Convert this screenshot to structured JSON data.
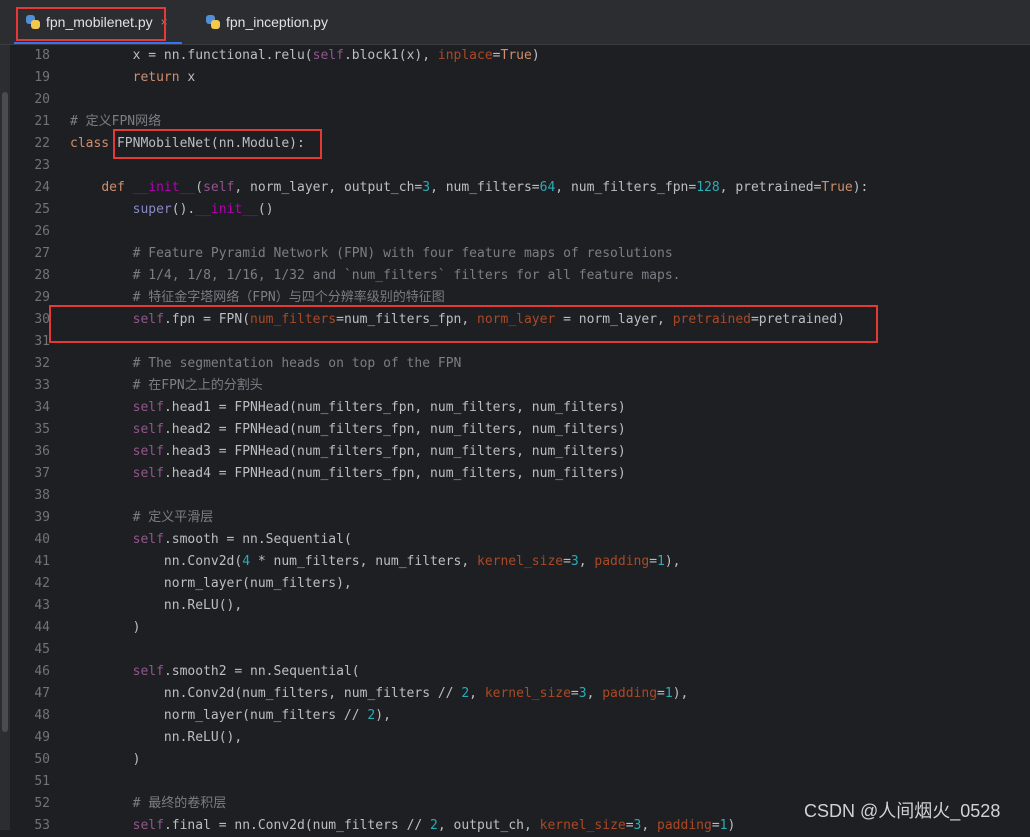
{
  "tabs": [
    {
      "label": "fpn_mobilenet.py",
      "close": "×",
      "active": true
    },
    {
      "label": "fpn_inception.py",
      "active": false
    }
  ],
  "watermark": "CSDN @人间烟火_0528",
  "colors": {
    "background": "#1e1f22",
    "keyword": "#cf8e6d",
    "comment": "#7a7e85",
    "number": "#2aacb8",
    "keyword_argument": "#aa4926",
    "self": "#94558d",
    "dunder": "#b200b2",
    "highlight_box": "#e53935",
    "active_tab_underline": "#3574f0"
  },
  "code_lines": [
    {
      "n": "18",
      "tokens": [
        [
          "",
          "        x = nn.functional.relu("
        ],
        [
          "self",
          "self"
        ],
        [
          "",
          ".block1(x), "
        ],
        [
          "kwarg",
          "inplace"
        ],
        [
          "",
          "="
        ],
        [
          "kw",
          "True"
        ],
        [
          "",
          ")"
        ]
      ]
    },
    {
      "n": "19",
      "tokens": [
        [
          "",
          "        "
        ],
        [
          "kw",
          "return"
        ],
        [
          "",
          " x"
        ]
      ]
    },
    {
      "n": "20",
      "tokens": []
    },
    {
      "n": "21",
      "tokens": [
        [
          "cm",
          "# 定义FPN网络"
        ]
      ]
    },
    {
      "n": "22",
      "tokens": [
        [
          "kw",
          "class"
        ],
        [
          "",
          " FPNMobileNet(nn.Module):"
        ]
      ]
    },
    {
      "n": "23",
      "tokens": []
    },
    {
      "n": "24",
      "tokens": [
        [
          "",
          "    "
        ],
        [
          "kw",
          "def"
        ],
        [
          "",
          " "
        ],
        [
          "dun",
          "__init__"
        ],
        [
          "",
          "("
        ],
        [
          "self",
          "self"
        ],
        [
          "",
          ", norm_layer, output_ch="
        ],
        [
          "num",
          "3"
        ],
        [
          "",
          ", num_filters="
        ],
        [
          "num",
          "64"
        ],
        [
          "",
          ", num_filters_fpn="
        ],
        [
          "num",
          "128"
        ],
        [
          "",
          ", pretrained="
        ],
        [
          "kw",
          "True"
        ],
        [
          "",
          "):"
        ]
      ]
    },
    {
      "n": "25",
      "tokens": [
        [
          "",
          "        "
        ],
        [
          "bi",
          "super"
        ],
        [
          "",
          "()."
        ],
        [
          "dun",
          "__init__"
        ],
        [
          "",
          "()"
        ]
      ]
    },
    {
      "n": "26",
      "tokens": []
    },
    {
      "n": "27",
      "tokens": [
        [
          "",
          "        "
        ],
        [
          "cm",
          "# Feature Pyramid Network (FPN) with four feature maps of resolutions"
        ]
      ]
    },
    {
      "n": "28",
      "tokens": [
        [
          "",
          "        "
        ],
        [
          "cm",
          "# 1/4, 1/8, 1/16, 1/32 and `num_filters` filters for all feature maps."
        ]
      ]
    },
    {
      "n": "29",
      "tokens": [
        [
          "",
          "        "
        ],
        [
          "cm",
          "# 特征金字塔网络（FPN）与四个分辨率级别的特征图"
        ]
      ]
    },
    {
      "n": "30",
      "tokens": [
        [
          "",
          "        "
        ],
        [
          "self",
          "self"
        ],
        [
          "",
          ".fpn = FPN("
        ],
        [
          "kwarg",
          "num_filters"
        ],
        [
          "",
          "=num_filters_fpn, "
        ],
        [
          "kwarg",
          "norm_layer"
        ],
        [
          "",
          " = norm_layer, "
        ],
        [
          "kwarg",
          "pretrained"
        ],
        [
          "",
          "=pretrained)"
        ]
      ]
    },
    {
      "n": "31",
      "tokens": []
    },
    {
      "n": "32",
      "tokens": [
        [
          "",
          "        "
        ],
        [
          "cm",
          "# The segmentation heads on top of the FPN"
        ]
      ]
    },
    {
      "n": "33",
      "tokens": [
        [
          "",
          "        "
        ],
        [
          "cm",
          "# 在FPN之上的分割头"
        ]
      ]
    },
    {
      "n": "34",
      "tokens": [
        [
          "",
          "        "
        ],
        [
          "self",
          "self"
        ],
        [
          "",
          ".head1 = FPNHead(num_filters_fpn, num_filters, num_filters)"
        ]
      ]
    },
    {
      "n": "35",
      "tokens": [
        [
          "",
          "        "
        ],
        [
          "self",
          "self"
        ],
        [
          "",
          ".head2 = FPNHead(num_filters_fpn, num_filters, num_filters)"
        ]
      ]
    },
    {
      "n": "36",
      "tokens": [
        [
          "",
          "        "
        ],
        [
          "self",
          "self"
        ],
        [
          "",
          ".head3 = FPNHead(num_filters_fpn, num_filters, num_filters)"
        ]
      ]
    },
    {
      "n": "37",
      "tokens": [
        [
          "",
          "        "
        ],
        [
          "self",
          "self"
        ],
        [
          "",
          ".head4 = FPNHead(num_filters_fpn, num_filters, num_filters)"
        ]
      ]
    },
    {
      "n": "38",
      "tokens": []
    },
    {
      "n": "39",
      "tokens": [
        [
          "",
          "        "
        ],
        [
          "cm",
          "# 定义平滑层"
        ]
      ]
    },
    {
      "n": "40",
      "tokens": [
        [
          "",
          "        "
        ],
        [
          "self",
          "self"
        ],
        [
          "",
          ".smooth = nn.Sequential("
        ]
      ]
    },
    {
      "n": "41",
      "tokens": [
        [
          "",
          "            nn.Conv2d("
        ],
        [
          "num",
          "4"
        ],
        [
          "",
          " * num_filters, num_filters, "
        ],
        [
          "kwarg",
          "kernel_size"
        ],
        [
          "",
          "="
        ],
        [
          "num",
          "3"
        ],
        [
          "",
          ", "
        ],
        [
          "kwarg",
          "padding"
        ],
        [
          "",
          "="
        ],
        [
          "num",
          "1"
        ],
        [
          "",
          "),"
        ]
      ]
    },
    {
      "n": "42",
      "tokens": [
        [
          "",
          "            norm_layer(num_filters),"
        ]
      ]
    },
    {
      "n": "43",
      "tokens": [
        [
          "",
          "            nn.ReLU(),"
        ]
      ]
    },
    {
      "n": "44",
      "tokens": [
        [
          "",
          "        )"
        ]
      ]
    },
    {
      "n": "45",
      "tokens": []
    },
    {
      "n": "46",
      "tokens": [
        [
          "",
          "        "
        ],
        [
          "self",
          "self"
        ],
        [
          "",
          ".smooth2 = nn.Sequential("
        ]
      ]
    },
    {
      "n": "47",
      "tokens": [
        [
          "",
          "            nn.Conv2d(num_filters, num_filters // "
        ],
        [
          "num",
          "2"
        ],
        [
          "",
          ", "
        ],
        [
          "kwarg",
          "kernel_size"
        ],
        [
          "",
          "="
        ],
        [
          "num",
          "3"
        ],
        [
          "",
          ", "
        ],
        [
          "kwarg",
          "padding"
        ],
        [
          "",
          "="
        ],
        [
          "num",
          "1"
        ],
        [
          "",
          "),"
        ]
      ]
    },
    {
      "n": "48",
      "tokens": [
        [
          "",
          "            norm_layer(num_filters // "
        ],
        [
          "num",
          "2"
        ],
        [
          "",
          "),"
        ]
      ]
    },
    {
      "n": "49",
      "tokens": [
        [
          "",
          "            nn.ReLU(),"
        ]
      ]
    },
    {
      "n": "50",
      "tokens": [
        [
          "",
          "        )"
        ]
      ]
    },
    {
      "n": "51",
      "tokens": []
    },
    {
      "n": "52",
      "tokens": [
        [
          "",
          "        "
        ],
        [
          "cm",
          "# 最终的卷积层"
        ]
      ]
    },
    {
      "n": "53",
      "tokens": [
        [
          "",
          "        "
        ],
        [
          "self",
          "self"
        ],
        [
          "",
          ".final = nn.Conv2d(num_filters // "
        ],
        [
          "num",
          "2"
        ],
        [
          "",
          ", output_ch, "
        ],
        [
          "kwarg",
          "kernel_size"
        ],
        [
          "",
          "="
        ],
        [
          "num",
          "3"
        ],
        [
          "",
          ", "
        ],
        [
          "kwarg",
          "padding"
        ],
        [
          "",
          "="
        ],
        [
          "num",
          "1"
        ],
        [
          "",
          ")"
        ]
      ]
    }
  ]
}
